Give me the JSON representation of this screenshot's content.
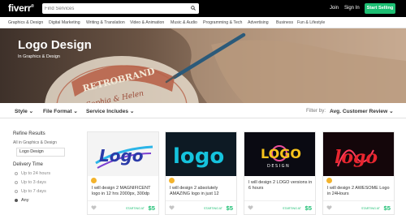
{
  "topbar": {
    "logo": "fiverr",
    "logo_mark": "®",
    "search_placeholder": "Find Services",
    "join": "Join",
    "sign_in": "Sign In",
    "start_selling": "Start Selling"
  },
  "categories": [
    "Graphics & Design",
    "Digital Marketing",
    "Writing & Translation",
    "Video & Animation",
    "Music & Audio",
    "Programming & Tech",
    "Advertising",
    "Business",
    "Fun & Lifestyle"
  ],
  "hero": {
    "title": "Logo Design",
    "breadcrumb": "In Graphics & Design",
    "photo_text_1": "RETROBRAND",
    "photo_text_2": "Sophia & Helen"
  },
  "filters": {
    "style": "Style",
    "file_format": "File Format",
    "service_includes": "Service Includes",
    "filter_by": "Filter by:",
    "sort_value": "Avg. Customer Review"
  },
  "sidebar": {
    "refine": "Refine Results",
    "all_in": "All in Graphics & Design",
    "current": "Logo Design",
    "delivery_title": "Delivery Time",
    "delivery_options": [
      "Up to 24 hours",
      "Up to 3 days",
      "Up to 7 days",
      "Any"
    ],
    "selected_option": "Any"
  },
  "gigs": [
    {
      "title": "I will design 2 MAGNIFICENT logo in 12 hrs 2000px, 300dp",
      "badge": true,
      "starting_at": "STARTING AT",
      "price": "$5",
      "thumb_text": "Logo"
    },
    {
      "title": "I will design 2 absolutely AMAZING logo in just 12",
      "badge": true,
      "starting_at": "STARTING AT",
      "price": "$5",
      "thumb_text": "logo"
    },
    {
      "title": "I will design 2 LOGO versions in 6 hours",
      "badge": false,
      "starting_at": "STARTING AT",
      "price": "$5",
      "thumb_text": "LOGO",
      "thumb_subtext": "DESIGN"
    },
    {
      "title": "I will design 2 AWESOME Logo in 24Hours",
      "badge": true,
      "starting_at": "STARTING AT",
      "price": "$5",
      "thumb_text": "logo"
    }
  ],
  "colors": {
    "brand_green": "#1dbf73",
    "topbar": "#000000",
    "badge": "#f3b32c"
  }
}
